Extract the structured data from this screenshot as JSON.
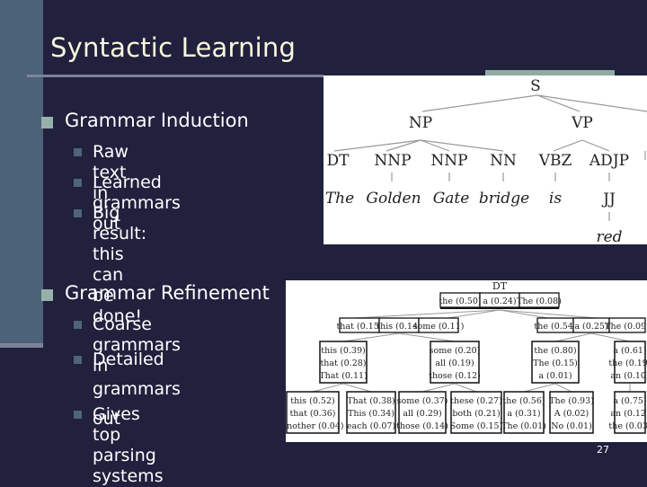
{
  "slide": {
    "title": "Syntactic Learning",
    "page_number": "27",
    "colors": {
      "background": "#21203d",
      "sidebar": "#4b6279",
      "title_text": "#fbf8dc",
      "accent": "#91aaa3"
    }
  },
  "bullets": [
    {
      "label": "Grammar Induction",
      "children": [
        "Raw text in",
        "Learned grammars out",
        "Big result: this can be",
        "done!"
      ]
    },
    {
      "label": "Grammar Refinement",
      "children": [
        "Coarse grammars in",
        "Detailed grammars",
        "out",
        "Gives top parsing",
        "systems"
      ]
    }
  ],
  "parse_tree": {
    "root": "S",
    "phrases": [
      "NP",
      "VP"
    ],
    "pos_tags": [
      "DT",
      "NNP",
      "NNP",
      "NN",
      "VBZ",
      "ADJP",
      "JJ"
    ],
    "words": [
      "The",
      "Golden",
      "Gate",
      "bridge",
      "is",
      "red"
    ]
  },
  "refinement_tree": {
    "root_label": "DT",
    "root_box": [
      "the (0.50)",
      "a (0.24)",
      "The (0.08)"
    ],
    "level1": [
      [
        "that (0.15)",
        "this (0.14)",
        "some (0.11)"
      ],
      [
        "the (0.54)",
        "a (0.25)",
        "The (0.09)"
      ]
    ],
    "level2": [
      [
        "this (0.39)",
        "that (0.28)",
        "That (0.11)"
      ],
      [
        "some (0.20)",
        "all (0.19)",
        "those (0.12)"
      ],
      [
        "the (0.80)",
        "The (0.15)",
        "a (0.01)"
      ],
      [
        "a (0.61)",
        "the (0.19)",
        "an (0.10)"
      ]
    ],
    "level3": [
      [
        "this (0.52)",
        "that (0.36)",
        "another (0.04)"
      ],
      [
        "That (0.38)",
        "This (0.34)",
        "each (0.07)"
      ],
      [
        "some (0.37)",
        "all (0.29)",
        "those (0.14)"
      ],
      [
        "these (0.27)",
        "both (0.21)",
        "Some (0.15)"
      ],
      [
        "the (0.56)",
        "a (0.31)",
        "The (0.01)"
      ],
      [
        "The (0.93)",
        "A (0.02)",
        "No (0.01)"
      ],
      [
        "a (0.75)",
        "an (0.12)",
        "the (0.03)"
      ]
    ]
  }
}
